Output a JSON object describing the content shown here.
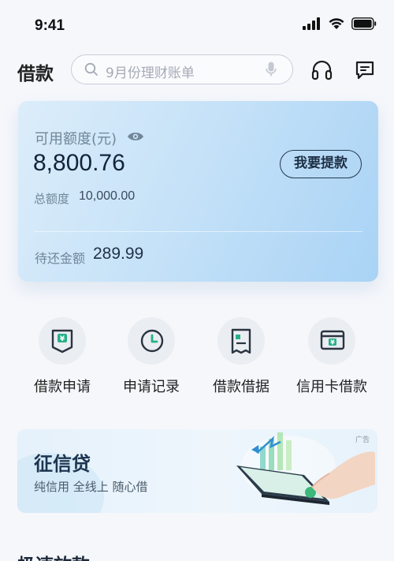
{
  "status_bar": {
    "time": "9:41"
  },
  "header": {
    "title": "借款",
    "search_placeholder": "9月份理财账单"
  },
  "credit_card": {
    "available_label": "可用额度(元)",
    "available_amount": "8,800.76",
    "withdraw_label": "我要提款",
    "total_label": "总额度",
    "total_value": "10,000.00",
    "due_label": "待还金额",
    "due_value": "289.99"
  },
  "shortcuts": [
    {
      "label": "借款申请",
      "icon": "loan-apply-icon"
    },
    {
      "label": "申请记录",
      "icon": "clock-icon"
    },
    {
      "label": "借款借据",
      "icon": "receipt-icon"
    },
    {
      "label": "信用卡借款",
      "icon": "credit-card-loan-icon"
    }
  ],
  "promo_banner": {
    "title": "征信贷",
    "subtitle": "纯信用  全线上  随心借",
    "ad_label": "广告"
  },
  "next_section": {
    "title": "极速放款"
  },
  "colors": {
    "background": "#f5f7fb",
    "card_gradient_start": "#dcedfa",
    "card_gradient_end": "#a9d3f5",
    "text_primary": "#1f2a3a",
    "icon_circle": "#eaedf2"
  }
}
